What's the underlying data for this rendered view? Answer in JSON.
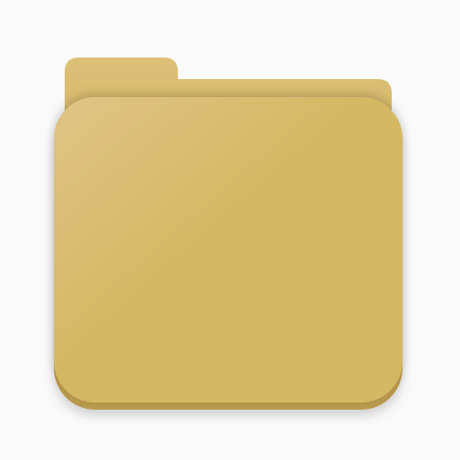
{
  "icon": {
    "name": "folder-icon",
    "colors": {
      "background": "#fafafa",
      "back_panel": "#d4b664",
      "back_panel_top": "#dcc077",
      "front_light": "#dfc485",
      "front_main": "#d5b863",
      "front_edge": "#b89a4e",
      "shadow": "#000000"
    }
  }
}
